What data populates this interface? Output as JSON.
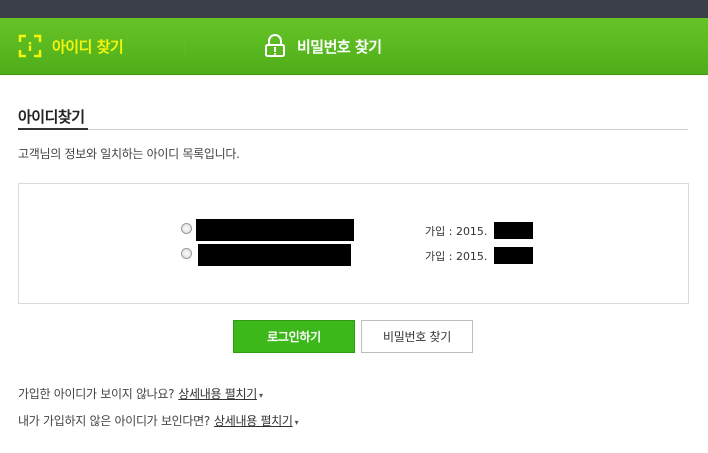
{
  "tabs": {
    "find_id": "아이디 찾기",
    "find_pw": "비밀번호 찾기"
  },
  "section": {
    "title": "아이디찾기",
    "description": "고객님의 정보와 일치하는 아이디 목록입니다."
  },
  "results": [
    {
      "join_label": "가입 : 2015."
    },
    {
      "join_label": "가입 : 2015."
    }
  ],
  "buttons": {
    "login": "로그인하기",
    "find_password": "비밀번호 찾기"
  },
  "help": {
    "not_visible_question": "가입한 아이디가 보이지 않나요?",
    "not_visible_link": "상세내용 펼치기",
    "unknown_id_question": "내가 가입하지 않은 아이디가 보인다면?",
    "unknown_id_link": "상세내용 펼치기",
    "caret": "▾"
  },
  "colors": {
    "accent_green": "#4fae19",
    "active_tab_text": "#f4f40d",
    "login_button": "#3cb81a"
  },
  "icons": {
    "find_id_tab": "id-card-focus-icon",
    "find_pw_tab": "lock-alert-icon"
  }
}
